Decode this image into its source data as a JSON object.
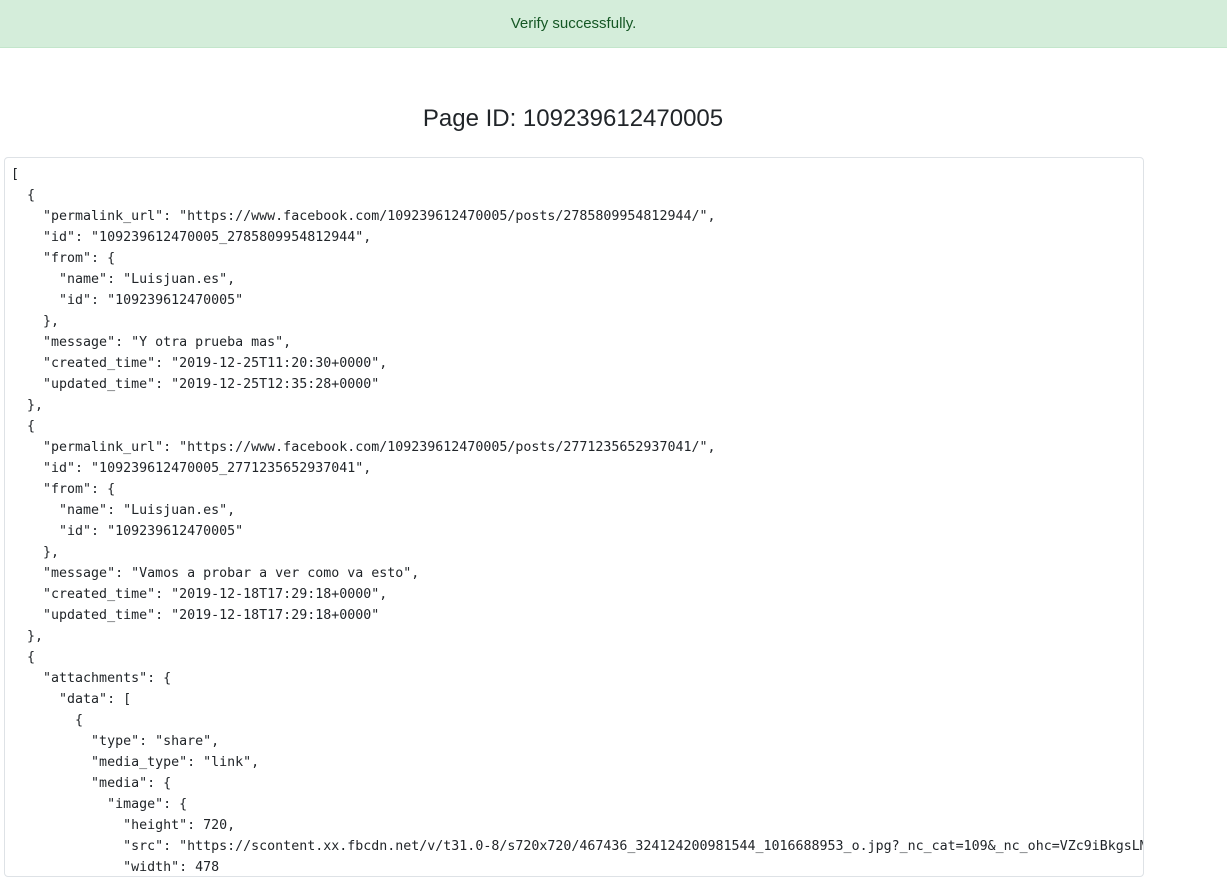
{
  "alert": {
    "message": "Verify successfully."
  },
  "page": {
    "title": "Page ID: 109239612470005"
  },
  "json_output": "[\n  {\n    \"permalink_url\": \"https://www.facebook.com/109239612470005/posts/2785809954812944/\",\n    \"id\": \"109239612470005_2785809954812944\",\n    \"from\": {\n      \"name\": \"Luisjuan.es\",\n      \"id\": \"109239612470005\"\n    },\n    \"message\": \"Y otra prueba mas\",\n    \"created_time\": \"2019-12-25T11:20:30+0000\",\n    \"updated_time\": \"2019-12-25T12:35:28+0000\"\n  },\n  {\n    \"permalink_url\": \"https://www.facebook.com/109239612470005/posts/2771235652937041/\",\n    \"id\": \"109239612470005_2771235652937041\",\n    \"from\": {\n      \"name\": \"Luisjuan.es\",\n      \"id\": \"109239612470005\"\n    },\n    \"message\": \"Vamos a probar a ver como va esto\",\n    \"created_time\": \"2019-12-18T17:29:18+0000\",\n    \"updated_time\": \"2019-12-18T17:29:18+0000\"\n  },\n  {\n    \"attachments\": {\n      \"data\": [\n        {\n          \"type\": \"share\",\n          \"media_type\": \"link\",\n          \"media\": {\n            \"image\": {\n              \"height\": 720,\n              \"src\": \"https://scontent.xx.fbcdn.net/v/t31.0-8/s720x720/467436_324124200981544_1016688953_o.jpg?_nc_cat=109&_nc_ohc=VZc9iBkgsLM\n              \"width\": 478"
}
